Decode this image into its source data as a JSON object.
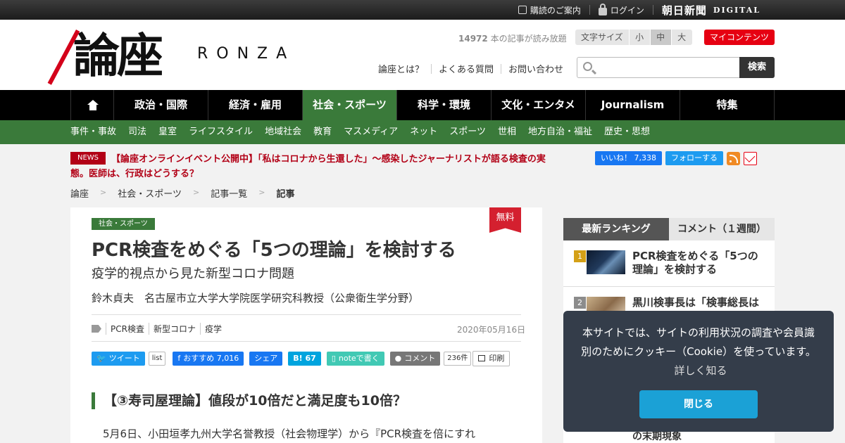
{
  "topbar": {
    "subscribe_label": "購読のご案内",
    "login_label": "ログイン",
    "brand_name": "朝日新聞",
    "brand_sub": "DIGITAL"
  },
  "header": {
    "logo_kanji": "論座",
    "logo_roman": "RONZA",
    "readable_count": "14972",
    "readable_suffix": " 本の記事が読み放題",
    "font_size_label": "文字サイズ",
    "font_sizes": [
      "小",
      "中",
      "大"
    ],
    "font_size_selected": "中",
    "my_contents_label": "マイコンテンツ",
    "links": [
      "論座とは？",
      "よくある質問",
      "お問い合わせ"
    ],
    "search_placeholder": "",
    "search_button": "検索"
  },
  "nav": {
    "items": [
      "政治・国際",
      "経済・雇用",
      "社会・スポーツ",
      "科学・環境",
      "文化・エンタメ",
      "Journalism",
      "特集"
    ],
    "active": "社会・スポーツ"
  },
  "subnav": {
    "items": [
      "事件・事故",
      "司法",
      "皇室",
      "ライフスタイル",
      "地域社会",
      "教育",
      "マスメディア",
      "ネット",
      "スポーツ",
      "世相",
      "地方自治・福祉",
      "歴史・思想"
    ]
  },
  "news": {
    "badge": "NEWS",
    "text": "【論座オンラインイベント公開中】「私はコロナから生還した」～感染したジャーナリストが語る検査の実態。医師は、行政はどうする？"
  },
  "social_top": {
    "fb_like": "いいね！ 7,338",
    "tw_follow": "フォローする"
  },
  "breadcrumb": {
    "items": [
      "論座",
      "社会・スポーツ",
      "記事一覧",
      "記事"
    ]
  },
  "article": {
    "category": "社会・スポーツ",
    "free_badge": "無料",
    "title": "PCR検査をめぐる「5つの理論」を検討する",
    "subtitle": "疫学的視点から見た新型コロナ問題",
    "author": "鈴木貞夫　名古屋市立大学大学院医学研究科教授（公衆衛生学分野）",
    "tags": [
      "PCR検査",
      "新型コロナ",
      "疫学"
    ],
    "date": "2020年05月16日",
    "share": {
      "tweet": "ツイート",
      "list": "list",
      "fb_recommend": "おすすめ 7,016",
      "fb_share": "シェア",
      "hatena": "B! 67",
      "note": "noteで書く",
      "comment": "コメント",
      "comment_count": "236件",
      "print": "印刷"
    },
    "heading": "【③寿司屋理論】値段が10倍だと満足度も10倍？",
    "body_first_line": "5月6日、小田垣孝九州大学名誉教授（社会物理学）から『PCR検査を倍にすれ"
  },
  "sidebar": {
    "tabs": [
      "最新ランキング",
      "コメント（１週間）"
    ],
    "active_tab": "最新ランキング",
    "ranking": [
      {
        "rank": "1",
        "title": "PCR検査をめぐる「5つの理論」を検討する"
      },
      {
        "rank": "2",
        "title": "黒川検事長は「検事総長は"
      }
    ],
    "bottom_text": "の末期現象"
  },
  "cookie": {
    "text": "本サイトでは、サイトの利用状況の調査や会員識別のためにクッキー（Cookie）を使っています。",
    "link": "詳しく知る",
    "close_button": "閉じる"
  }
}
